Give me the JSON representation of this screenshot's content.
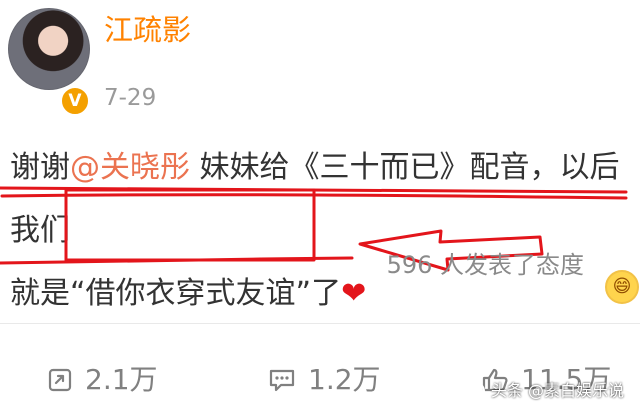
{
  "post": {
    "author": "江疏影",
    "time": "7-29",
    "badge": "V",
    "text": {
      "part1": "谢谢",
      "mention": "@关晓彤",
      "part2": " 妹妹给《三十而已》配音，以后我们",
      "line2_prefix": "就是“",
      "highlight": "借你衣穿式友谊",
      "line2_suffix": "”了"
    }
  },
  "reactions": {
    "summary": "596 人发表了态度"
  },
  "actions": {
    "repost": "2.1万",
    "comment": "1.2万",
    "like": "11.5万"
  },
  "watermark": {
    "text": "头条 @素白娱乐说"
  },
  "colors": {
    "accent": "#ff8200",
    "mention": "#eb7350",
    "annotation": "#e3151b"
  },
  "icons": {
    "heart": "heart-icon",
    "reaction": "emoji-icon",
    "repost": "repost-icon",
    "comment": "comment-icon",
    "like": "thumbs-up-icon"
  }
}
